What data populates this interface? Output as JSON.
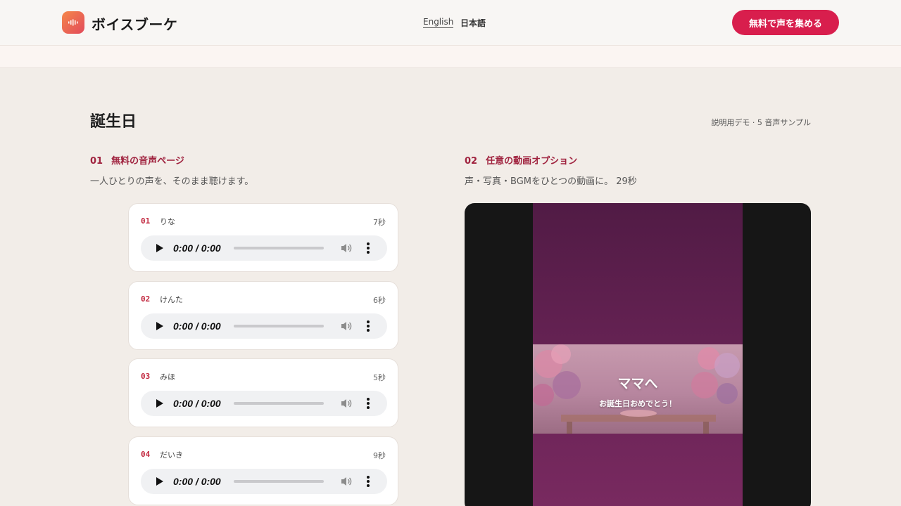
{
  "header": {
    "brand": "ボイスブーケ",
    "lang_en": "English",
    "lang_ja": "日本語",
    "cta": "無料で声を集める",
    "logo_icon": "sound-wave-icon"
  },
  "page": {
    "title": "誕生日",
    "meta": "説明用デモ · 5 音声サンプル"
  },
  "section1": {
    "num": "01",
    "title": "無料の音声ページ",
    "desc": "一人ひとりの声を、そのまま聴けます。"
  },
  "section2": {
    "num": "02",
    "title": "任意の動画オプション",
    "desc": "声・写真・BGMをひとつの動画に。 29秒"
  },
  "tracks": [
    {
      "idx": "01",
      "name": "りな",
      "dur": "7秒",
      "time": "0:00 / 0:00"
    },
    {
      "idx": "02",
      "name": "けんた",
      "dur": "6秒",
      "time": "0:00 / 0:00"
    },
    {
      "idx": "03",
      "name": "みほ",
      "dur": "5秒",
      "time": "0:00 / 0:00"
    },
    {
      "idx": "04",
      "name": "だいき",
      "dur": "9秒",
      "time": "0:00 / 0:00"
    }
  ],
  "video": {
    "title": "ママへ",
    "subtitle": "お誕生日おめでとう！"
  },
  "colors": {
    "accent": "#d81e4d",
    "section_heading": "#a0233f",
    "background": "#f2ede8"
  }
}
